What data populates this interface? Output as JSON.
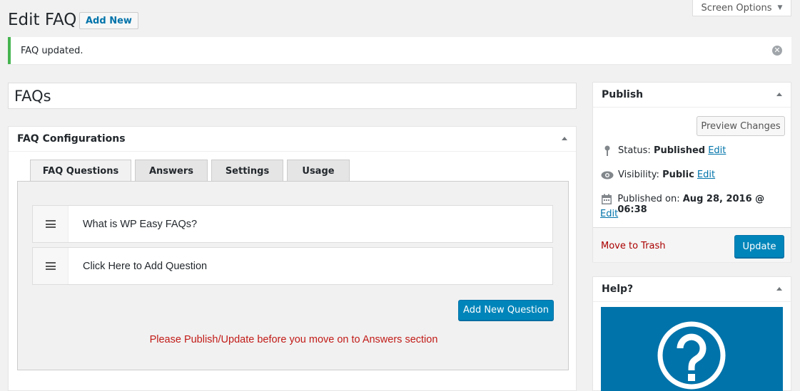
{
  "header": {
    "screen_options_label": "Screen Options",
    "title": "Edit FAQ",
    "add_new_label": "Add New"
  },
  "notice": {
    "message": "FAQ updated."
  },
  "post": {
    "title": "FAQs"
  },
  "faq_config": {
    "heading": "FAQ Configurations",
    "tabs": [
      {
        "label": "FAQ Questions",
        "active": true
      },
      {
        "label": "Answers",
        "active": false
      },
      {
        "label": "Settings",
        "active": false
      },
      {
        "label": "Usage",
        "active": false
      }
    ],
    "questions": [
      {
        "text": "What is WP Easy FAQs?"
      },
      {
        "text": "Click Here to Add Question"
      }
    ],
    "add_question_label": "Add New Question",
    "warning": "Please Publish/Update before you move on to Answers section"
  },
  "publish": {
    "heading": "Publish",
    "preview_label": "Preview Changes",
    "status_label": "Status:",
    "status_value": "Published",
    "visibility_label": "Visibility:",
    "visibility_value": "Public",
    "published_on_label": "Published on:",
    "published_on_value": "Aug 28, 2016 @ 06:38",
    "edit_label": "Edit",
    "trash_label": "Move to Trash",
    "update_label": "Update"
  },
  "help": {
    "heading": "Help?"
  },
  "colors": {
    "primary": "#0085ba",
    "link": "#0073aa",
    "success": "#46b450",
    "warning": "#c11b17",
    "trash": "#a00000"
  }
}
